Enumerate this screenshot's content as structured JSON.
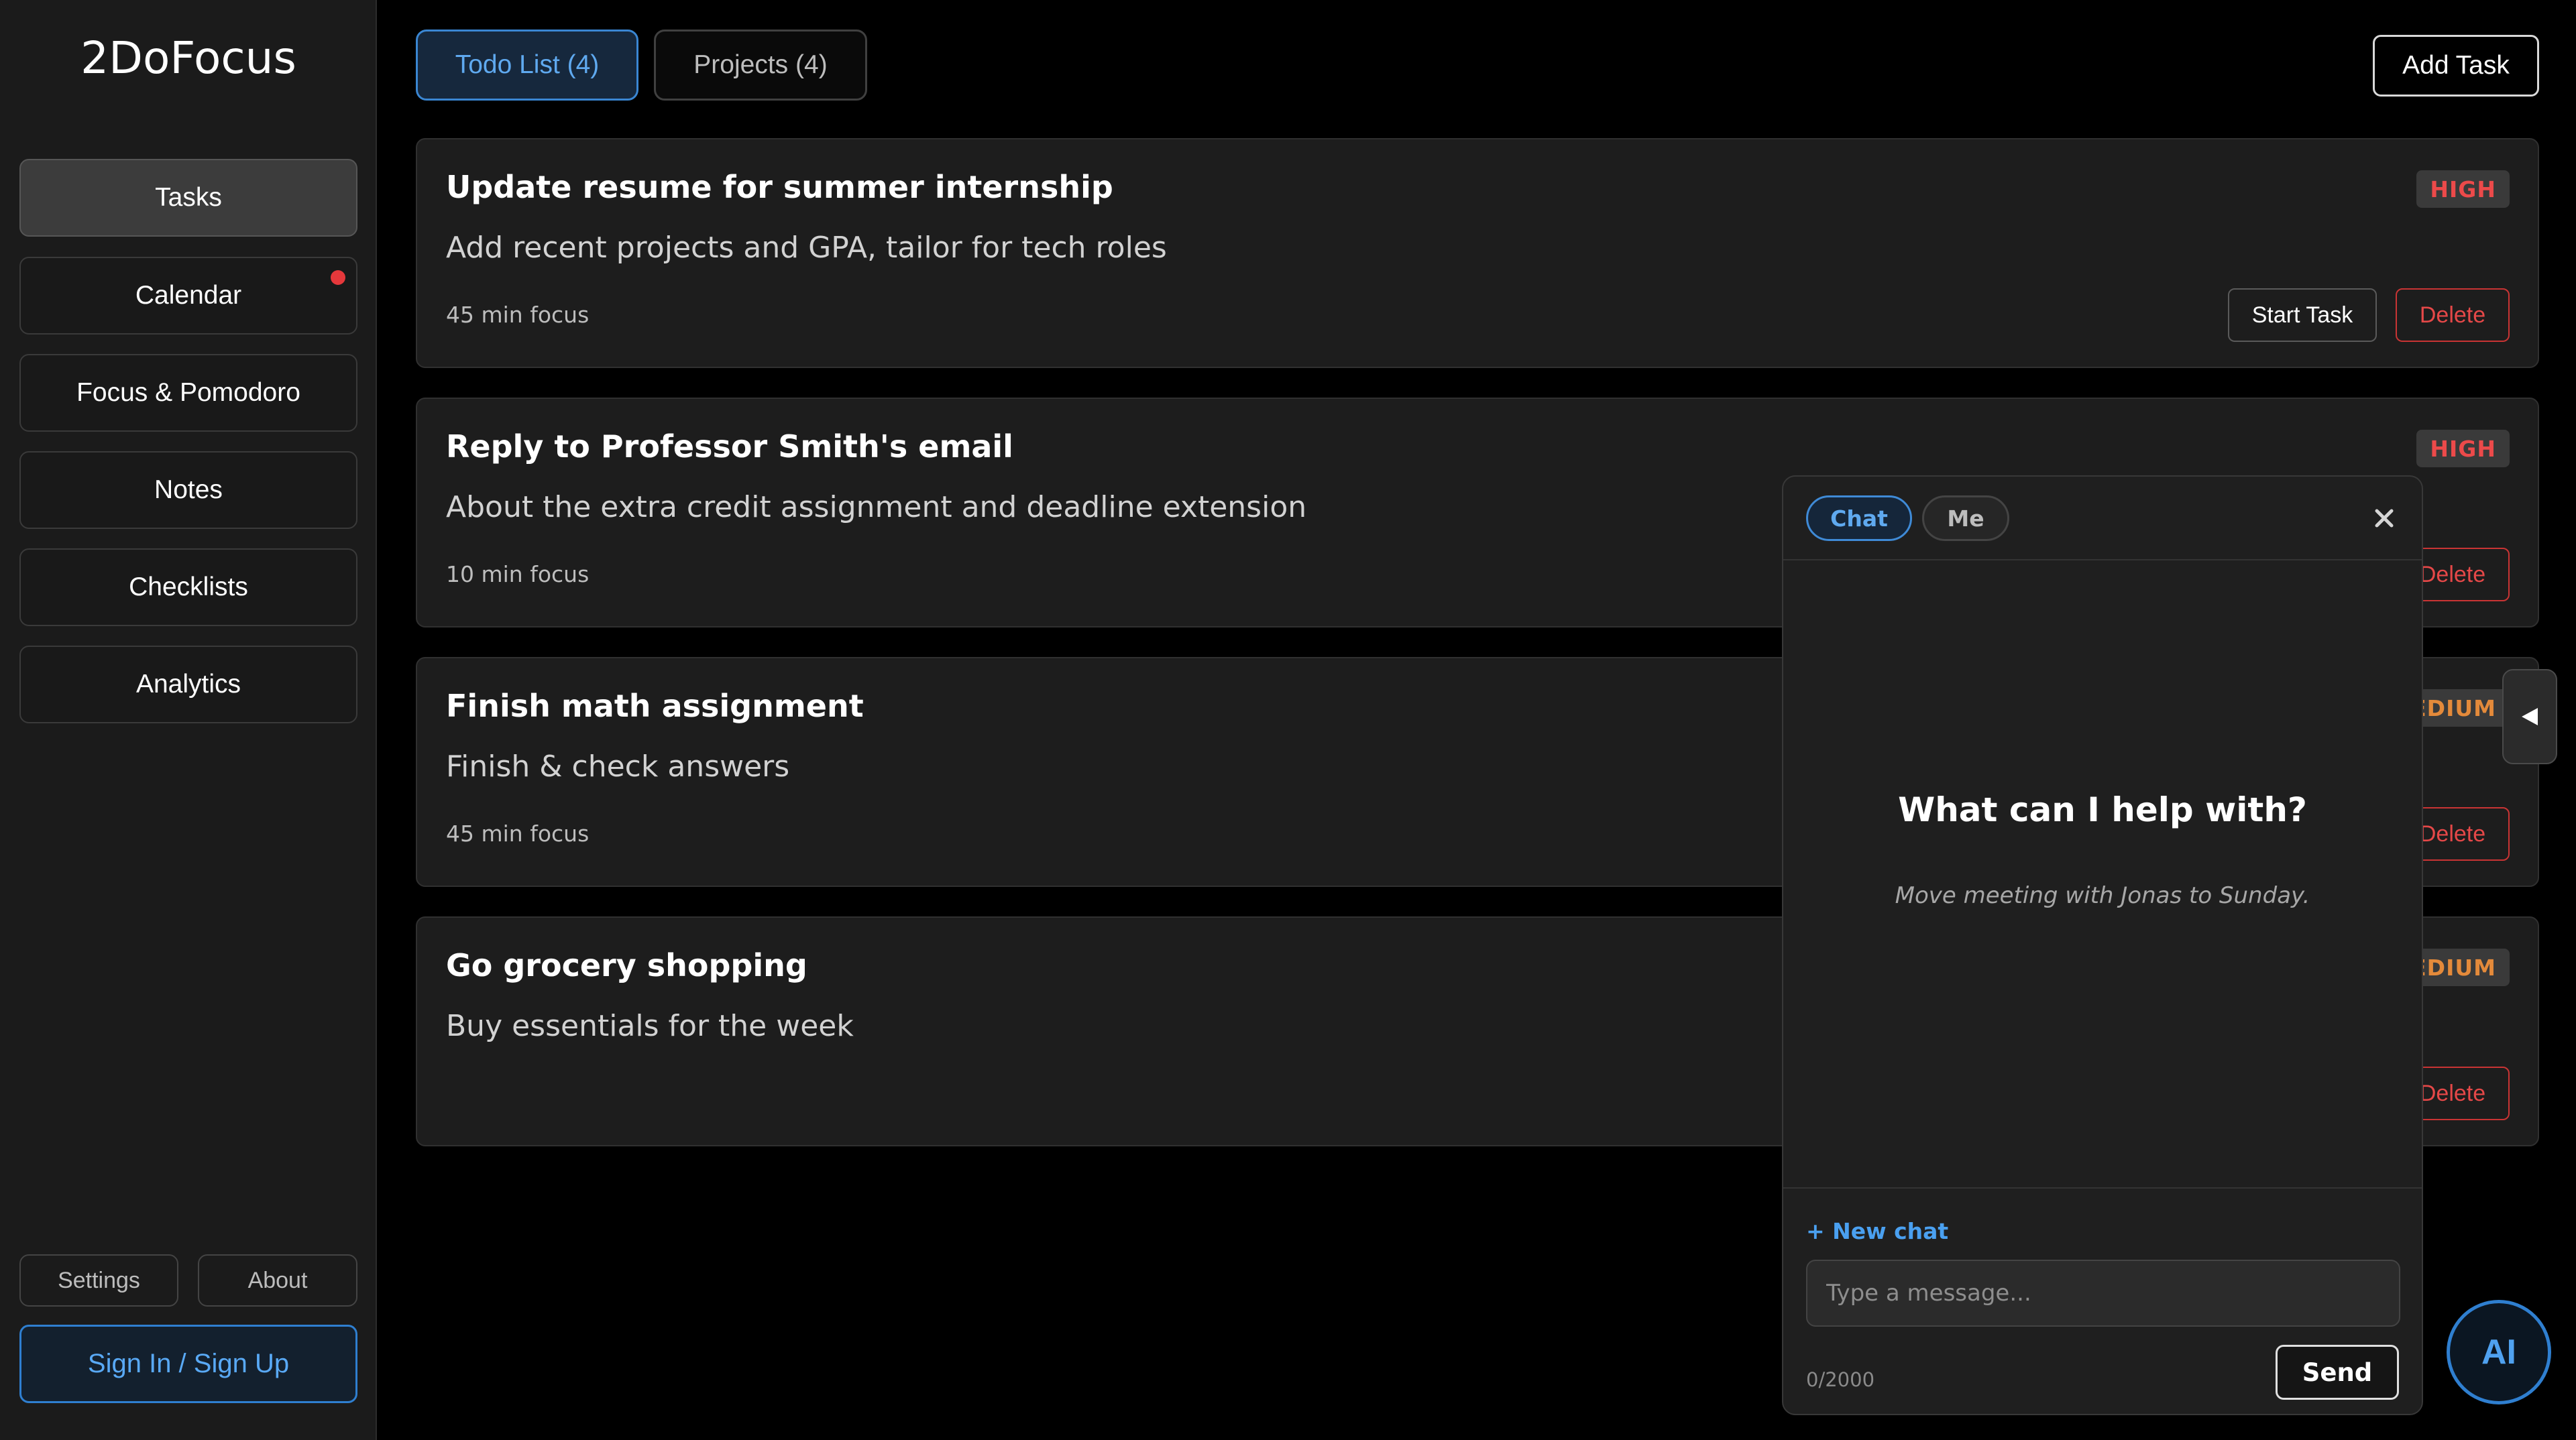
{
  "app": {
    "title": "2DoFocus"
  },
  "sidebar": {
    "nav": [
      {
        "label": "Tasks",
        "active": true
      },
      {
        "label": "Calendar",
        "notification_dot": true
      },
      {
        "label": "Focus & Pomodoro"
      },
      {
        "label": "Notes"
      },
      {
        "label": "Checklists"
      },
      {
        "label": "Analytics"
      }
    ],
    "settings_label": "Settings",
    "about_label": "About",
    "signin_label": "Sign In / Sign Up"
  },
  "header": {
    "tabs": [
      {
        "label": "Todo List (4)",
        "active": true
      },
      {
        "label": "Projects (4)",
        "active": false
      }
    ],
    "add_task_label": "Add Task"
  },
  "tasks": [
    {
      "title": "Update resume for summer internship",
      "description": "Add recent projects and GPA, tailor for tech roles",
      "focus": "45 min focus",
      "priority": "HIGH",
      "start_label": "Start Task",
      "delete_label": "Delete"
    },
    {
      "title": "Reply to Professor Smith's email",
      "description": "About the extra credit assignment and deadline extension",
      "focus": "10 min focus",
      "priority": "HIGH",
      "delete_label": "Delete"
    },
    {
      "title": "Finish math assignment",
      "description": "Finish & check answers",
      "focus": "45 min focus",
      "priority": "EDIUM",
      "delete_label": "Delete"
    },
    {
      "title": "Go grocery shopping",
      "description": "Buy essentials for the week",
      "priority": "EDIUM",
      "delete_label": "Delete"
    }
  ],
  "chat": {
    "tabs": [
      {
        "label": "Chat",
        "active": true
      },
      {
        "label": "Me",
        "active": false
      }
    ],
    "heading": "What can I help with?",
    "hint": "Move meeting with Jonas to Sunday.",
    "new_chat_label": "+ New chat",
    "input_placeholder": "Type a message...",
    "input_value": "",
    "counter": "0/2000",
    "send_label": "Send"
  },
  "ai_button_label": "AI",
  "icons": {
    "close": "close-icon",
    "handle": "chevron-left-icon"
  },
  "colors": {
    "accent": "#3a86d2",
    "high": "#ec4a4a",
    "medium": "#e48a3a",
    "notification": "#e5383b"
  }
}
